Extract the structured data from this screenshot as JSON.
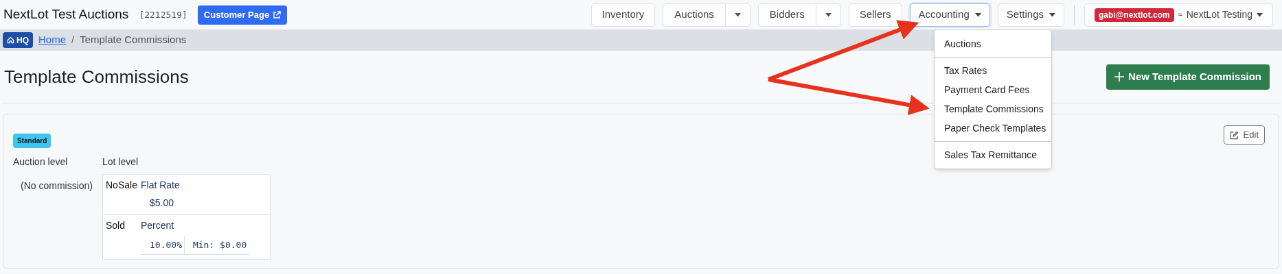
{
  "header": {
    "title": "NextLot Test Auctions",
    "account_id": "[2212519]",
    "customer_page_button": "Customer Page"
  },
  "nav": [
    {
      "kind": "plain",
      "label": "Inventory",
      "expanded": false
    },
    {
      "kind": "split",
      "label": "Auctions",
      "expanded": false
    },
    {
      "kind": "split",
      "label": "Bidders",
      "expanded": false
    },
    {
      "kind": "plain",
      "label": "Sellers",
      "expanded": false
    },
    {
      "kind": "dropdown",
      "label": "Accounting",
      "expanded": true
    },
    {
      "kind": "dropdown",
      "label": "Settings",
      "expanded": false
    }
  ],
  "profile": {
    "email": "gabi@nextlot.com",
    "separator": "≈",
    "organization": "NextLot Testing"
  },
  "breadcrumb": {
    "hq_button": "HQ",
    "separator": "/",
    "items": [
      {
        "label": "Home",
        "kind": "link"
      },
      {
        "label": "Template Commissions",
        "kind": "current"
      }
    ]
  },
  "accounting_menu": [
    [
      "Auctions"
    ],
    [
      "Tax Rates",
      "Payment Card Fees",
      "Template Commissions",
      "Paper Check Templates"
    ],
    [
      "Sales Tax Remittance"
    ]
  ],
  "page": {
    "title": "Template Commissions",
    "new_button": "New Template Commission"
  },
  "commission_card": {
    "badge": "Standard",
    "edit_button": "Edit",
    "auction_level_label": "Auction level",
    "lot_level_label": "Lot level",
    "auction_level_value": "(No commission)",
    "lot_rows": [
      {
        "label": "NoSale",
        "type": "Flat Rate",
        "values": [
          "$5.00"
        ]
      },
      {
        "label": "Sold",
        "type": "Percent",
        "values": [
          "10.00%",
          "Min: $0.00"
        ]
      }
    ]
  },
  "annotations": [
    {
      "kind": "arrow"
    },
    {
      "kind": "arrow"
    }
  ]
}
